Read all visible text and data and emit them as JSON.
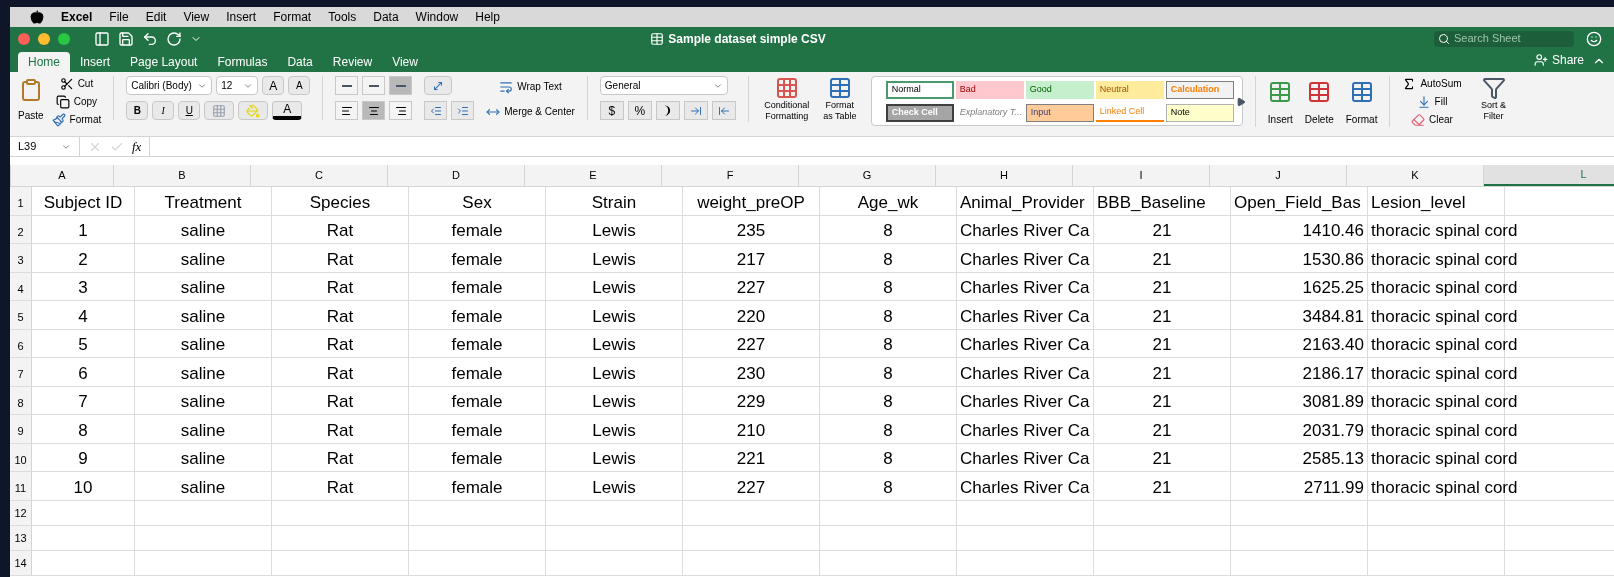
{
  "menubar": {
    "app": "Excel",
    "items": [
      "File",
      "Edit",
      "View",
      "Insert",
      "Format",
      "Tools",
      "Data",
      "Window",
      "Help"
    ]
  },
  "window": {
    "title": "Sample dataset simple CSV",
    "search_placeholder": "Search Sheet",
    "share": "Share"
  },
  "tabs": [
    {
      "label": "Home",
      "selected": true
    },
    {
      "label": "Insert",
      "selected": false
    },
    {
      "label": "Page Layout",
      "selected": false
    },
    {
      "label": "Formulas",
      "selected": false
    },
    {
      "label": "Data",
      "selected": false
    },
    {
      "label": "Review",
      "selected": false
    },
    {
      "label": "View",
      "selected": false
    }
  ],
  "clipboard": {
    "paste": "Paste",
    "cut": "Cut",
    "copy": "Copy",
    "format": "Format"
  },
  "font": {
    "name": "Calibri (Body)",
    "size": "12",
    "grow": "A",
    "shrink": "A",
    "bold": "B",
    "italic": "I",
    "underline": "U",
    "font_color_letter": "A"
  },
  "alignment": {
    "vertical": [
      {
        "selected": false
      },
      {
        "selected": false
      },
      {
        "selected": true
      }
    ],
    "horizontal": [
      {
        "selected": false
      },
      {
        "selected": true
      },
      {
        "selected": false
      }
    ],
    "wrap": "Wrap Text",
    "merge": "Merge & Center"
  },
  "number": {
    "format": "General",
    "currency": "$",
    "percent": "%",
    "comma": "❩"
  },
  "styles_group": {
    "conditional": "Conditional Formatting",
    "table": "Format as Table",
    "styles": [
      {
        "label": "Normal",
        "kind": "normal"
      },
      {
        "label": "Bad",
        "kind": "bad"
      },
      {
        "label": "Good",
        "kind": "good"
      },
      {
        "label": "Neutral",
        "kind": "neutral"
      },
      {
        "label": "Calculation",
        "kind": "calculation"
      },
      {
        "label": "Check Cell",
        "kind": "check"
      },
      {
        "label": "Explanatory T...",
        "kind": "explanatory"
      },
      {
        "label": "Input",
        "kind": "input"
      },
      {
        "label": "Linked Cell",
        "kind": "linked"
      },
      {
        "label": "Note",
        "kind": "note"
      }
    ]
  },
  "cells_group": {
    "insert": "Insert",
    "delete": "Delete",
    "format": "Format"
  },
  "editing": {
    "autosum": "AutoSum",
    "fill": "Fill",
    "clear": "Clear",
    "sort": "Sort & Filter"
  },
  "formula_bar": {
    "name_box": "L39",
    "fx": "fx"
  },
  "sheet": {
    "columns": [
      {
        "label": "A",
        "selected": false
      },
      {
        "label": "B",
        "selected": false
      },
      {
        "label": "C",
        "selected": false
      },
      {
        "label": "D",
        "selected": false
      },
      {
        "label": "E",
        "selected": false
      },
      {
        "label": "F",
        "selected": false
      },
      {
        "label": "G",
        "selected": false
      },
      {
        "label": "H",
        "selected": false
      },
      {
        "label": "I",
        "selected": false
      },
      {
        "label": "J",
        "selected": false
      },
      {
        "label": "K",
        "selected": false
      },
      {
        "label": "L",
        "selected": true
      }
    ],
    "rows": [
      {
        "n": "1",
        "cells": [
          "Subject ID",
          "Treatment",
          "Species",
          "Sex",
          "Strain",
          "weight_preOP",
          "Age_wk",
          "Animal_Provider",
          "BBB_Baseline",
          "Open_Field_Bas",
          "Lesion_level"
        ]
      },
      {
        "n": "2",
        "cells": [
          "1",
          "saline",
          "Rat",
          "female",
          "Lewis",
          "235",
          "8",
          "Charles River Ca",
          "21",
          "1410.46",
          "thoracic spinal cord"
        ]
      },
      {
        "n": "3",
        "cells": [
          "2",
          "saline",
          "Rat",
          "female",
          "Lewis",
          "217",
          "8",
          "Charles River Ca",
          "21",
          "1530.86",
          "thoracic spinal cord"
        ]
      },
      {
        "n": "4",
        "cells": [
          "3",
          "saline",
          "Rat",
          "female",
          "Lewis",
          "227",
          "8",
          "Charles River Ca",
          "21",
          "1625.25",
          "thoracic spinal cord"
        ]
      },
      {
        "n": "5",
        "cells": [
          "4",
          "saline",
          "Rat",
          "female",
          "Lewis",
          "220",
          "8",
          "Charles River Ca",
          "21",
          "3484.81",
          "thoracic spinal cord"
        ]
      },
      {
        "n": "6",
        "cells": [
          "5",
          "saline",
          "Rat",
          "female",
          "Lewis",
          "227",
          "8",
          "Charles River Ca",
          "21",
          "2163.40",
          "thoracic spinal cord"
        ]
      },
      {
        "n": "7",
        "cells": [
          "6",
          "saline",
          "Rat",
          "female",
          "Lewis",
          "230",
          "8",
          "Charles River Ca",
          "21",
          "2186.17",
          "thoracic spinal cord"
        ]
      },
      {
        "n": "8",
        "cells": [
          "7",
          "saline",
          "Rat",
          "female",
          "Lewis",
          "229",
          "8",
          "Charles River Ca",
          "21",
          "3081.89",
          "thoracic spinal cord"
        ]
      },
      {
        "n": "9",
        "cells": [
          "8",
          "saline",
          "Rat",
          "female",
          "Lewis",
          "210",
          "8",
          "Charles River Ca",
          "21",
          "2031.79",
          "thoracic spinal cord"
        ]
      },
      {
        "n": "10",
        "cells": [
          "9",
          "saline",
          "Rat",
          "female",
          "Lewis",
          "221",
          "8",
          "Charles River Ca",
          "21",
          "2585.13",
          "thoracic spinal cord"
        ]
      },
      {
        "n": "11",
        "cells": [
          "10",
          "saline",
          "Rat",
          "female",
          "Lewis",
          "227",
          "8",
          "Charles River Ca",
          "21",
          "2711.99",
          "thoracic spinal cord"
        ]
      },
      {
        "n": "12",
        "cells": []
      },
      {
        "n": "13",
        "cells": []
      },
      {
        "n": "14",
        "cells": []
      }
    ]
  }
}
